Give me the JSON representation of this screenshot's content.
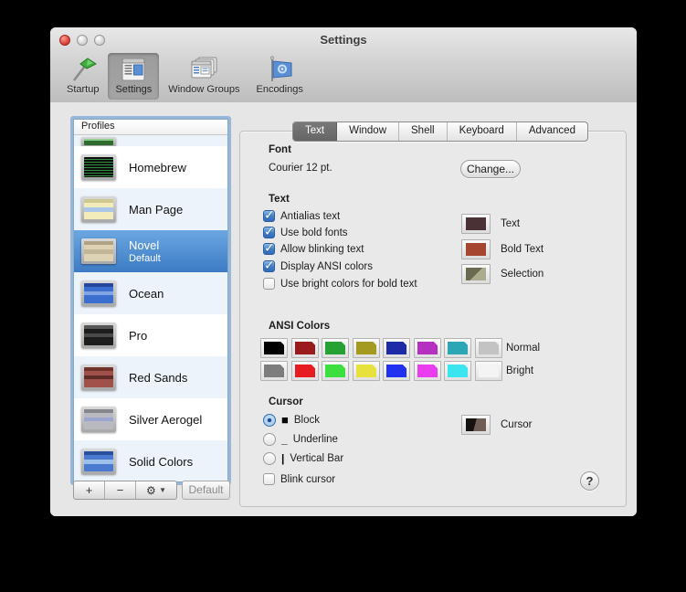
{
  "window": {
    "title": "Settings"
  },
  "toolbar": {
    "items": [
      {
        "label": "Startup"
      },
      {
        "label": "Settings"
      },
      {
        "label": "Window Groups"
      },
      {
        "label": "Encodings"
      }
    ]
  },
  "sidebar": {
    "header": "Profiles",
    "partial_thumb": "linear-gradient(180deg,#8fce8f 0 2px,#2e6b2e 2px 100%)",
    "profiles": [
      {
        "name": "Homebrew",
        "thumb": "repeating-linear-gradient(180deg,#0d0d0d 0 2px,#2f8f3f 2px 3px)"
      },
      {
        "name": "Man Page",
        "thumb": "linear-gradient(180deg,#cfc890 0 4px,#f2ecba 4px 9px,#aac6e8 9px 14px,#f2ecba 14px 100%)"
      },
      {
        "name": "Novel",
        "subtitle": "Default",
        "thumb": "linear-gradient(180deg,#b0a385 0 4px,#ded2b4 4px 9px,#c2b698 9px 14px,#ded2b4 14px 100%)"
      },
      {
        "name": "Ocean",
        "thumb": "linear-gradient(180deg,#27479c 0 4px,#3a6ecf 4px 9px,#83a5e4 9px 13px,#3a6ecf 13px 100%)"
      },
      {
        "name": "Pro",
        "thumb": "linear-gradient(180deg,#565656 0 4px,#1d1d1d 4px 9px,#4a4a4a 9px 13px,#1d1d1d 13px 100%)"
      },
      {
        "name": "Red Sands",
        "thumb": "linear-gradient(180deg,#6f332c 0 4px,#a0524a 4px 9px,#5e2d28 9px 13px,#a0524a 13px 100%)"
      },
      {
        "name": "Silver Aerogel",
        "thumb": "linear-gradient(180deg,#85868d 0 4px,#b9bac0 4px 9px,#9aa6d0 9px 13px,#b9bac0 13px 100%)"
      },
      {
        "name": "Solid Colors",
        "thumb": "linear-gradient(180deg,#29509c 0 4px,#4a7ad0 4px 9px,#9cc0ea 9px 14px,#4a7ad0 14px 100%)"
      }
    ],
    "buttons": {
      "add": "+",
      "remove": "−",
      "gear": "⚙",
      "caret": "▼",
      "default_label": "Default"
    }
  },
  "tabs": [
    {
      "label": "Text"
    },
    {
      "label": "Window"
    },
    {
      "label": "Shell"
    },
    {
      "label": "Keyboard"
    },
    {
      "label": "Advanced"
    }
  ],
  "panel": {
    "font": {
      "heading": "Font",
      "value": "Courier 12 pt.",
      "change_button": "Change..."
    },
    "text": {
      "heading": "Text",
      "checkboxes": [
        {
          "label": "Antialias text",
          "checked": true
        },
        {
          "label": "Use bold fonts",
          "checked": true
        },
        {
          "label": "Allow blinking text",
          "checked": true
        },
        {
          "label": "Display ANSI colors",
          "checked": true
        },
        {
          "label": "Use bright colors for bold text",
          "checked": false
        }
      ],
      "color_wells": [
        {
          "label": "Text",
          "color": "#4a3136"
        },
        {
          "label": "Bold Text",
          "color": "#a54730"
        },
        {
          "label": "Selection",
          "color": "linear-gradient(135deg,#6a6a50 50%,#abac8e 50%)"
        }
      ]
    },
    "ansi": {
      "heading": "ANSI Colors",
      "normal_label": "Normal",
      "bright_label": "Bright",
      "normal": [
        "#000000",
        "#9a1b1e",
        "#25a233",
        "#a59a20",
        "#1d2ba6",
        "#b52fc1",
        "#2aa6b4",
        "#c3c3c3"
      ],
      "bright": [
        "#7d7d7d",
        "#e61c21",
        "#3ddf3f",
        "#e6e13c",
        "#2032ef",
        "#eb3df0",
        "#3be5ef",
        "#f4f4f4"
      ]
    },
    "cursor": {
      "heading": "Cursor",
      "radios": [
        {
          "label": "Block",
          "glyph": "■",
          "selected": true
        },
        {
          "label": "Underline",
          "glyph": "_",
          "selected": false
        },
        {
          "label": "Vertical Bar",
          "glyph": "|",
          "selected": false
        }
      ],
      "blink_label": "Blink cursor",
      "well_label": "Cursor",
      "well_color": "linear-gradient(105deg,#161210 46%,#6e5e56 46%)"
    },
    "help": "?"
  }
}
